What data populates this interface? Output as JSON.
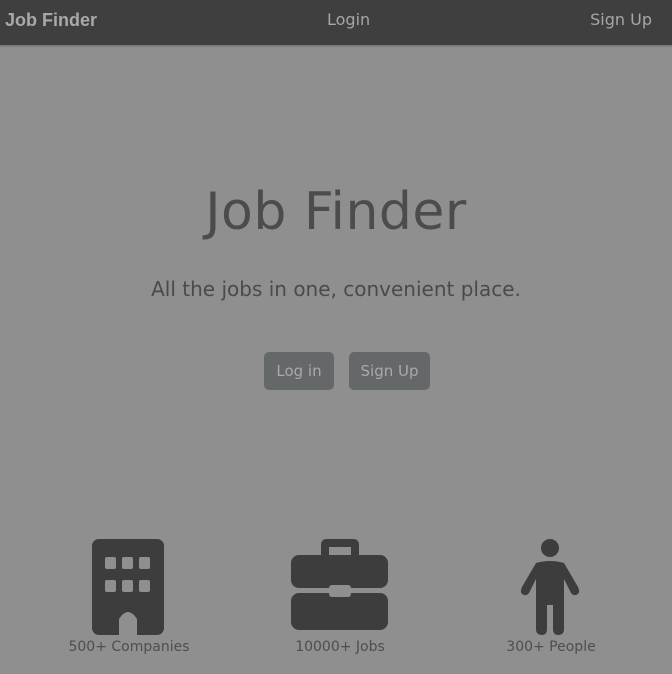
{
  "navbar": {
    "brand": "Job Finder",
    "login_label": "Login",
    "signup_label": "Sign Up"
  },
  "hero": {
    "title": "Job Finder",
    "subtitle": "All the jobs in one, convenient place.",
    "login_button": "Log in",
    "signup_button": "Sign Up"
  },
  "stats": [
    {
      "icon": "building-icon",
      "label": "500+ Companies"
    },
    {
      "icon": "briefcase-icon",
      "label": "10000+ Jobs"
    },
    {
      "icon": "person-icon",
      "label": "300+ People"
    }
  ],
  "colors": {
    "navbar": "#3f3f3f",
    "background": "#8f8f8f",
    "button": "#656869",
    "icon": "#3d3d3d"
  }
}
